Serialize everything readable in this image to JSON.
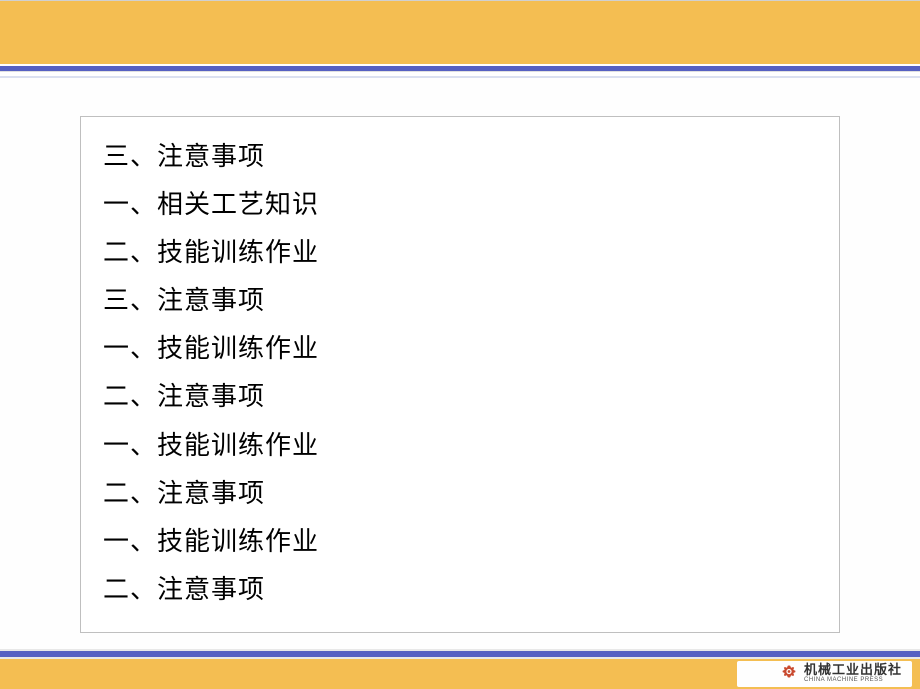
{
  "list": {
    "items": [
      "三、注意事项",
      "一、相关工艺知识",
      "二、技能训练作业",
      "三、注意事项",
      "一、技能训练作业",
      "二、注意事项",
      "一、技能训练作业",
      "二、注意事项",
      "一、技能训练作业",
      "二、注意事项"
    ]
  },
  "publisher": {
    "name_cn": "机械工业出版社",
    "name_en": "CHINA MACHINE PRESS",
    "icon": "gear-icon"
  },
  "colors": {
    "gold": "#f4be52",
    "blue": "#5660c2",
    "gear": "#c94a2f"
  }
}
